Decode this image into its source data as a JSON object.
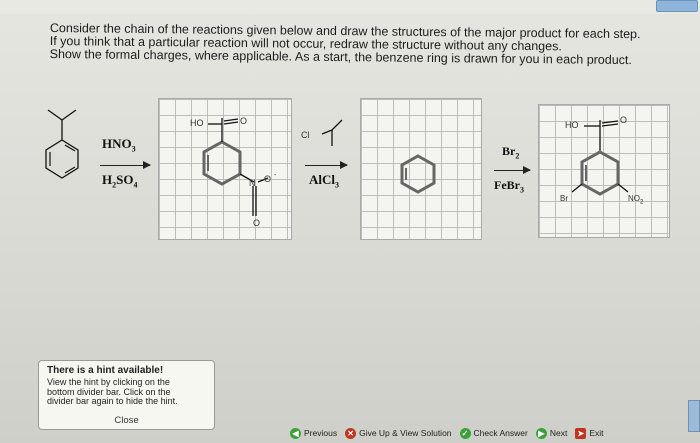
{
  "question": {
    "line1": "Consider the chain of the reactions given below and draw the structures of the major product for each step.",
    "line2": "If you think that a particular reaction will not occur, redraw the structure without any changes.",
    "line3": "Show the formal charges, where applicable. As a start, the benzene ring is drawn for you in each product."
  },
  "step1": {
    "reagent_top": "HNO",
    "reagent_top_sub": "3",
    "reagent_bottom_1": "H",
    "reagent_bottom_sub1": "2",
    "reagent_bottom_2": "SO",
    "reagent_bottom_sub2": "4"
  },
  "box1": {
    "label_ho": "HO",
    "label_o": "O",
    "label_n": "N",
    "label_o2": "O",
    "label_o3": "O",
    "label_charge": "-",
    "label_plus": "+"
  },
  "step2": {
    "label_cl": "Cl",
    "reagent": "AlCl",
    "reagent_sub": "3"
  },
  "step3": {
    "reagent_top": "Br",
    "reagent_top_sub": "2",
    "reagent_bottom": "FeBr",
    "reagent_bottom_sub": "3"
  },
  "box3": {
    "label_ho": "HO",
    "label_o": "O",
    "label_br": "Br",
    "label_no2": "NO",
    "label_no2_sub": "2"
  },
  "hint": {
    "title": "There is a hint available!",
    "body1": "View the hint by clicking on the",
    "body2": "bottom divider bar. Click on the",
    "body3": "divider bar again to hide the hint.",
    "close": "Close"
  },
  "footer": {
    "previous": "Previous",
    "give_up": "Give Up & View Solution",
    "check": "Check Answer",
    "next": "Next",
    "exit": "Exit"
  },
  "colors": {
    "green": "#3aa23a",
    "red": "#c2341f",
    "blue": "#2f6fb0"
  }
}
